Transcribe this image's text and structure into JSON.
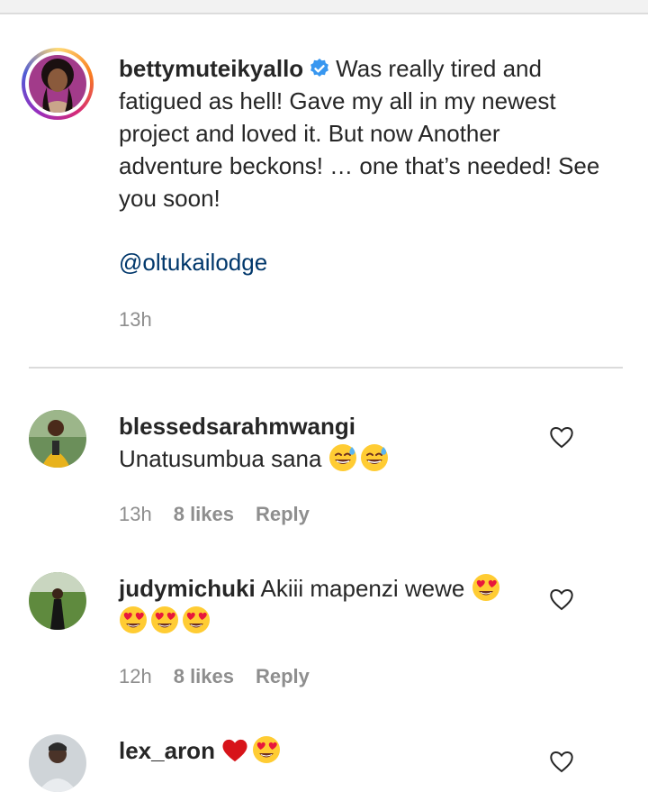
{
  "caption": {
    "username": "bettymuteikyallo",
    "verified": true,
    "text": "Was really tired and fatigued as hell! Gave my all in my newest project and loved it. But now Another adventure beckons! … one that’s needed! See you soon!",
    "mention": "@oltukailodge",
    "time": "13h"
  },
  "comments": [
    {
      "username": "blessedsarahmwangi",
      "text": "Unatusumbua sana",
      "emojis": [
        "sweat-smile",
        "sweat-smile"
      ],
      "time": "13h",
      "likes": "8 likes",
      "reply": "Reply"
    },
    {
      "username": "judymichuki",
      "text": "Akiii mapenzi wewe",
      "emojis": [
        "heart-eyes",
        "heart-eyes",
        "heart-eyes",
        "heart-eyes"
      ],
      "time": "12h",
      "likes": "8 likes",
      "reply": "Reply"
    },
    {
      "username": "lex_aron",
      "text": "",
      "emojis": [
        "red-heart",
        "heart-eyes"
      ]
    }
  ],
  "colors": {
    "text": "#262626",
    "muted": "#8e8e8e",
    "link": "#00376b",
    "verified": "#3897f0",
    "divider": "#dbdbdb"
  }
}
